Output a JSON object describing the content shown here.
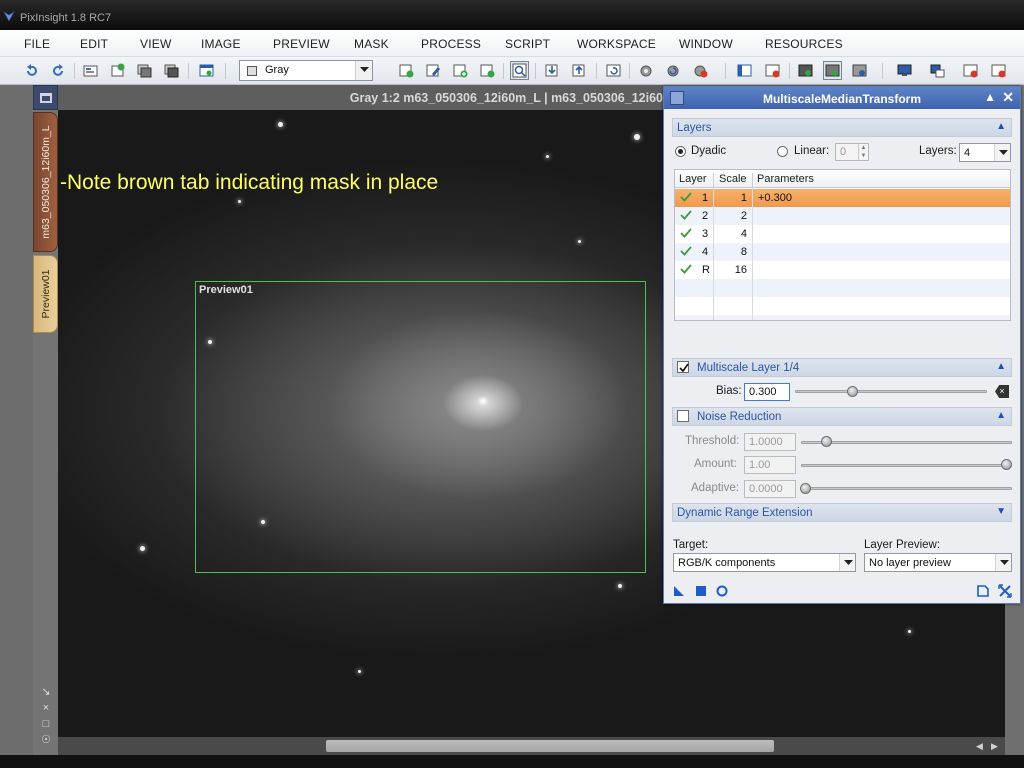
{
  "app": {
    "title": "PixInsight 1.8 RC7"
  },
  "menu": [
    "FILE",
    "EDIT",
    "VIEW",
    "IMAGE",
    "PREVIEW",
    "MASK",
    "PROCESS",
    "SCRIPT",
    "WORKSPACE",
    "WINDOW",
    "RESOURCES"
  ],
  "toolbar": {
    "colorspace_value": "Gray"
  },
  "image_window": {
    "title": "Gray 1:2 m63_050306_12i60m_L | m63_050306_12i60",
    "tab_main": "m63_050306_12i60m_L",
    "tab_preview": "Preview01",
    "preview_label": "Preview01",
    "annotation": "-Note brown tab indicating mask in place"
  },
  "colors": {
    "accent": "#3f63ad",
    "mask_tab": "#8e5236",
    "preview_tab": "#e1c48d",
    "selected_row": "#f4a55c",
    "annotation": "#ffff66",
    "preview_outline": "#4fbf54"
  },
  "dialog": {
    "title": "MultiscaleMedianTransform",
    "layers_section": "Layers",
    "dyadic_label": "Dyadic",
    "linear_label": "Linear:",
    "linear_value": "0",
    "layers_label": "Layers:",
    "layers_value": "4",
    "table": {
      "headers": [
        "Layer",
        "Scale",
        "Parameters"
      ],
      "rows": [
        {
          "layer": "1",
          "scale": "1",
          "params": "+0.300",
          "checked": true,
          "selected": true
        },
        {
          "layer": "2",
          "scale": "2",
          "params": "",
          "checked": true,
          "selected": false
        },
        {
          "layer": "3",
          "scale": "4",
          "params": "",
          "checked": true,
          "selected": false
        },
        {
          "layer": "4",
          "scale": "8",
          "params": "",
          "checked": true,
          "selected": false
        },
        {
          "layer": "R",
          "scale": "16",
          "params": "",
          "checked": true,
          "selected": false
        }
      ]
    },
    "multiscale_section": "Multiscale Layer 1/4",
    "bias_label": "Bias:",
    "bias_value": "0.300",
    "bias_level": 0.3,
    "noise_section": "Noise Reduction",
    "threshold_label": "Threshold:",
    "threshold_value": "1.0000",
    "amount_label": "Amount:",
    "amount_value": "1.00",
    "adaptive_label": "Adaptive:",
    "adaptive_value": "0.0000",
    "dre_section": "Dynamic Range Extension",
    "target_label": "Target:",
    "target_value": "RGB/K components",
    "layer_preview_label": "Layer Preview:",
    "layer_preview_value": "No layer preview"
  }
}
